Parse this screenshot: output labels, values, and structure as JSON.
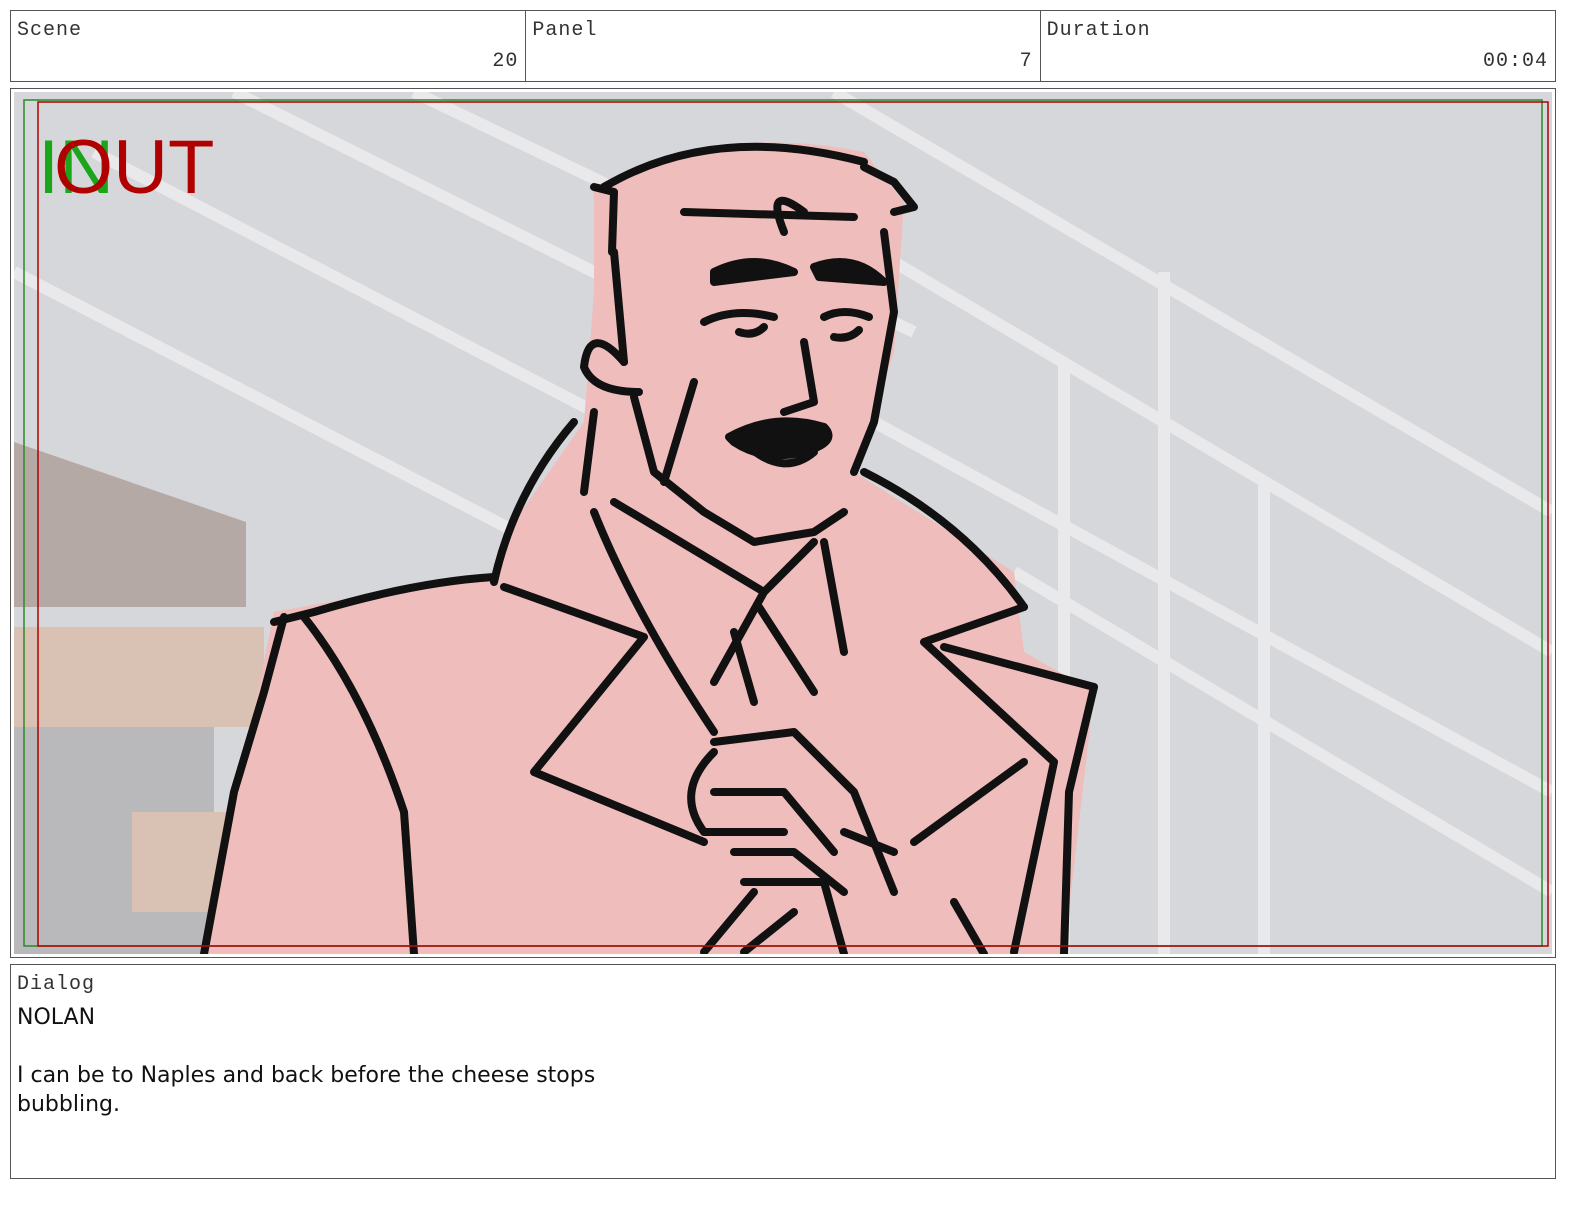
{
  "header": {
    "scene": {
      "label": "Scene",
      "value": "20"
    },
    "panel": {
      "label": "Panel",
      "value": "7"
    },
    "duration": {
      "label": "Duration",
      "value": "00:04"
    }
  },
  "frame": {
    "in_label": "IN",
    "out_label": "OUT",
    "colors": {
      "in": "#1aa51a",
      "out": "#b00000",
      "sketch_fill": "#efbdbb",
      "background": "#d6d7da"
    }
  },
  "dialog": {
    "label": "Dialog",
    "speaker": "NOLAN",
    "line": "I can be to Naples and back before the cheese stops bubbling."
  }
}
